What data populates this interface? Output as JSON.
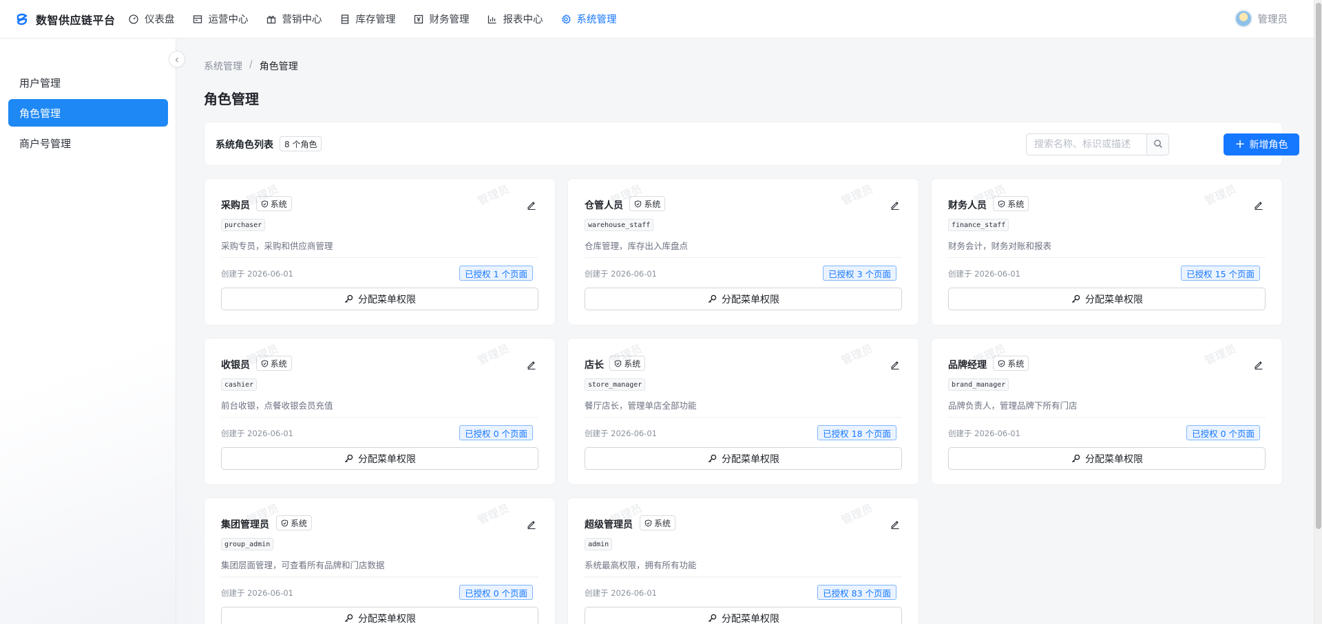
{
  "app": {
    "title": "数智供应链平台",
    "brand_color": "#1677ff"
  },
  "nav": [
    {
      "label": "仪表盘",
      "icon": "dashboard-icon"
    },
    {
      "label": "运营中心",
      "icon": "operations-icon"
    },
    {
      "label": "营销中心",
      "icon": "gift-icon"
    },
    {
      "label": "库存管理",
      "icon": "inventory-icon"
    },
    {
      "label": "财务管理",
      "icon": "finance-icon"
    },
    {
      "label": "报表中心",
      "icon": "chart-icon"
    },
    {
      "label": "系统管理",
      "icon": "gear-icon",
      "active": true
    }
  ],
  "user": {
    "name": "管理员"
  },
  "sidebar": {
    "items": [
      {
        "label": "用户管理"
      },
      {
        "label": "角色管理",
        "active": true
      },
      {
        "label": "商户号管理"
      }
    ]
  },
  "breadcrumb": {
    "parent": "系统管理",
    "separator": "/",
    "current": "角色管理"
  },
  "page": {
    "title": "角色管理"
  },
  "toolbar": {
    "list_title": "系统角色列表",
    "count_label": "8 个角色",
    "search_placeholder": "搜索名称、标识或描述",
    "add_label": "新增角色"
  },
  "card_labels": {
    "system_tag": "系统",
    "assign_label": "分配菜单权限",
    "watermark": "管理员"
  },
  "roles": [
    {
      "name": "采购员",
      "code": "purchaser",
      "desc": "采购专员，采购和供应商管理",
      "created": "创建于 2026-06-01",
      "auth": "已授权 1 个页面"
    },
    {
      "name": "仓管人员",
      "code": "warehouse_staff",
      "desc": "仓库管理，库存出入库盘点",
      "created": "创建于 2026-06-01",
      "auth": "已授权 3 个页面"
    },
    {
      "name": "财务人员",
      "code": "finance_staff",
      "desc": "财务会计，财务对账和报表",
      "created": "创建于 2026-06-01",
      "auth": "已授权 15 个页面"
    },
    {
      "name": "收银员",
      "code": "cashier",
      "desc": "前台收银，点餐收银会员充值",
      "created": "创建于 2026-06-01",
      "auth": "已授权 0 个页面"
    },
    {
      "name": "店长",
      "code": "store_manager",
      "desc": "餐厅店长，管理单店全部功能",
      "created": "创建于 2026-06-01",
      "auth": "已授权 18 个页面"
    },
    {
      "name": "品牌经理",
      "code": "brand_manager",
      "desc": "品牌负责人，管理品牌下所有门店",
      "created": "创建于 2026-06-01",
      "auth": "已授权 0 个页面"
    },
    {
      "name": "集团管理员",
      "code": "group_admin",
      "desc": "集团层面管理，可查看所有品牌和门店数据",
      "created": "创建于 2026-06-01",
      "auth": "已授权 0 个页面"
    },
    {
      "name": "超级管理员",
      "code": "admin",
      "desc": "系统最高权限，拥有所有功能",
      "created": "创建于 2026-06-01",
      "auth": "已授权 83 个页面"
    }
  ]
}
